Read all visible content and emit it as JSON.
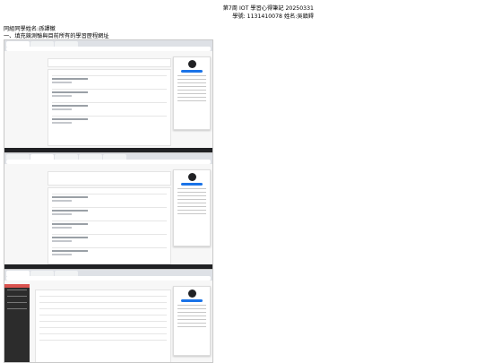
{
  "header": {
    "line1": "第7周 IOT 學習心得筆記 20250331",
    "line2": "學號: 1131410078     姓名:吳鎮鍀"
  },
  "intro": {
    "classmate": "同組同學姓名:孫譯徽",
    "instruction": "一、填充競測驗與目前所有的學習歷程網址"
  }
}
